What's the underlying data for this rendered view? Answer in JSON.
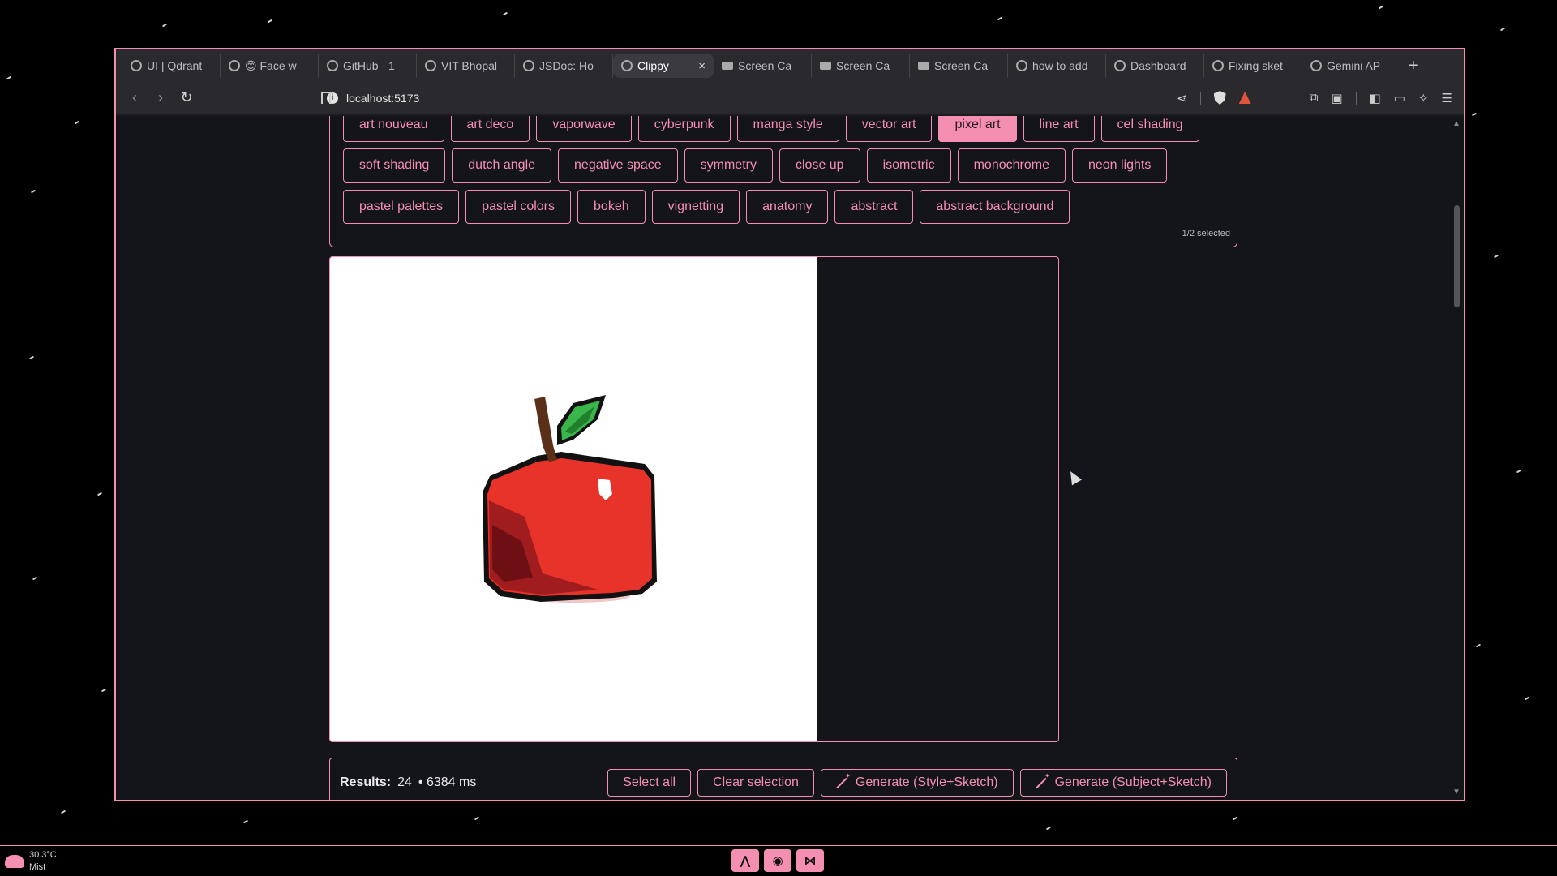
{
  "browser": {
    "tabs": [
      {
        "label": "UI | Qdrant",
        "active": false
      },
      {
        "label": "😊 Face w",
        "active": false
      },
      {
        "label": "GitHub - 1",
        "active": false
      },
      {
        "label": "VIT Bhopal",
        "active": false
      },
      {
        "label": "JSDoc: Ho",
        "active": false
      },
      {
        "label": "Clippy",
        "active": true
      },
      {
        "label": "Screen Ca",
        "active": false
      },
      {
        "label": "Screen Ca",
        "active": false
      },
      {
        "label": "Screen Ca",
        "active": false
      },
      {
        "label": "how to add",
        "active": false
      },
      {
        "label": "Dashboard",
        "active": false
      },
      {
        "label": "Fixing sket",
        "active": false
      },
      {
        "label": "Gemini AP",
        "active": false
      }
    ],
    "new_tab_symbol": "+",
    "close_symbol": "×",
    "url": "localhost:5173",
    "alert_count": "1"
  },
  "tags": {
    "row1": [
      "art nouveau",
      "art deco",
      "vaporwave",
      "cyberpunk",
      "manga style",
      "vector art",
      "pixel art",
      "line art",
      "cel shading"
    ],
    "row2": [
      "soft shading",
      "dutch angle",
      "negative space",
      "symmetry",
      "close up",
      "isometric",
      "monochrome",
      "neon lights"
    ],
    "row3": [
      "pastel palettes",
      "pastel colors",
      "bokeh",
      "vignetting",
      "anatomy",
      "abstract",
      "abstract background"
    ],
    "selected": "pixel art",
    "selected_count": "1/2 selected"
  },
  "image": {
    "subject": "pixel art red apple"
  },
  "results": {
    "label": "Results:",
    "count": "24",
    "time": "• 6384 ms",
    "select_all": "Select all",
    "clear_selection": "Clear selection",
    "generate_style": "Generate (Style+Sketch)",
    "generate_subject": "Generate (Subject+Sketch)"
  },
  "taskbar": {
    "temperature": "30.3°C",
    "condition": "Mist"
  },
  "colors": {
    "accent": "#f48fb1",
    "background": "#14141b"
  }
}
